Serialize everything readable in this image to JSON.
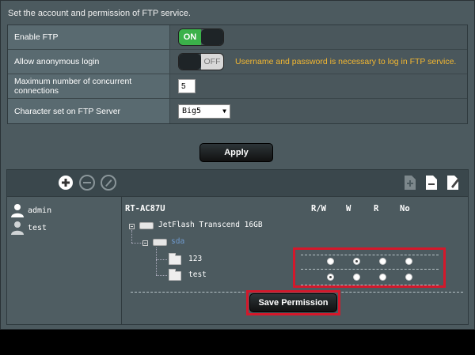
{
  "ftp": {
    "subtitle": "Set the account and permission of FTP service.",
    "enable_ftp": {
      "label": "Enable FTP",
      "state": "ON"
    },
    "anonymous": {
      "label": "Allow anonymous login",
      "state": "OFF",
      "note": "Username and password is necessary to log in FTP service."
    },
    "max_conn": {
      "label": "Maximum number of concurrent connections",
      "value": "5"
    },
    "charset": {
      "label": "Character set on FTP Server",
      "value": "Big5"
    },
    "apply_label": "Apply"
  },
  "toolbar": {
    "left_icons": [
      "add-icon",
      "remove-icon",
      "edit-icon"
    ],
    "right_icons": [
      "folder-add-icon",
      "folder-remove-icon",
      "rename-icon"
    ]
  },
  "users": [
    {
      "name": "admin"
    },
    {
      "name": "test"
    }
  ],
  "tree": {
    "router": "RT-AC87U",
    "columns": [
      "R/W",
      "W",
      "R",
      "No"
    ],
    "device": "JetFlash Transcend 16GB",
    "partition": "sda",
    "folders": [
      {
        "name": "123",
        "permission": "W"
      },
      {
        "name": "test",
        "permission": "R/W"
      }
    ]
  },
  "save_label": "Save Permission",
  "colors": {
    "accent_on": "#3bb14a",
    "note": "#f2b731",
    "highlight": "#d4182b"
  }
}
